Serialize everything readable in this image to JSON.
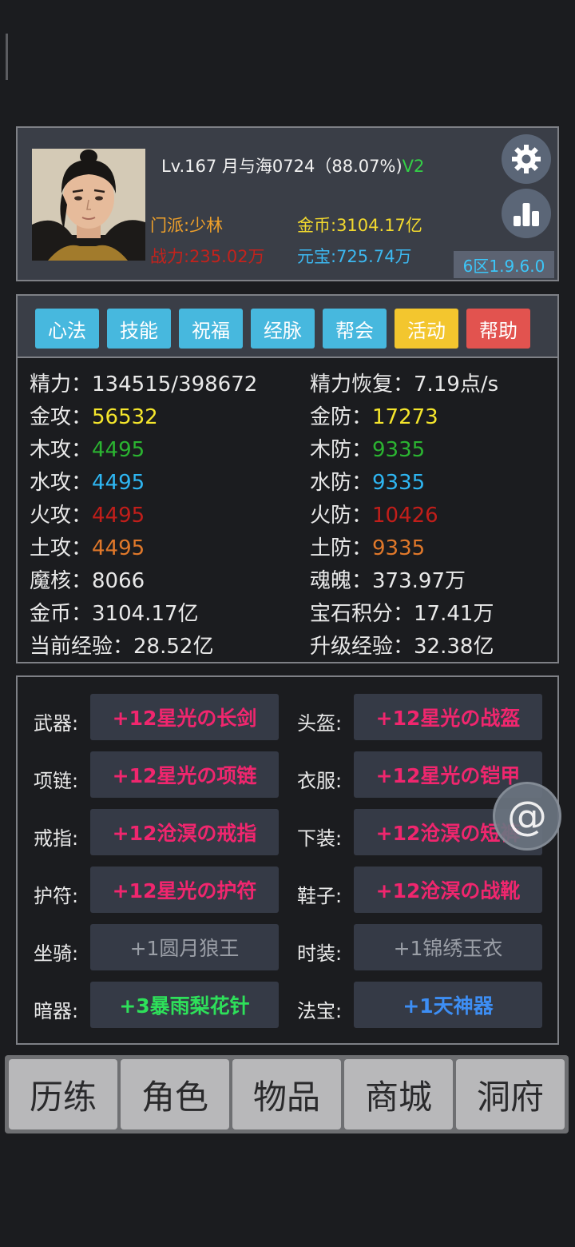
{
  "header": {
    "player_info": "Lv.167 月与海0724（88.07%)",
    "vip": "V2",
    "sect": "门派:少林",
    "power": "战力:235.02万",
    "gold": "金币:3104.17亿",
    "yuanbao": "元宝:725.74万",
    "server": "6区1.9.6.0",
    "icons": {
      "settings": "gear-icon",
      "stats": "bar-chart-icon"
    }
  },
  "tabs": [
    {
      "label": "心法",
      "color": "#47b8de"
    },
    {
      "label": "技能",
      "color": "#47b8de"
    },
    {
      "label": "祝福",
      "color": "#47b8de"
    },
    {
      "label": "经脉",
      "color": "#47b8de"
    },
    {
      "label": "帮会",
      "color": "#47b8de"
    },
    {
      "label": "活动",
      "color": "#f3c62e"
    },
    {
      "label": "帮助",
      "color": "#e2534f"
    }
  ],
  "stats": {
    "energy_label": "精力：",
    "energy_value": "134515/398672",
    "regen_label": "精力恢复：",
    "regen_value": "7.19点/s",
    "metal_atk_label": "金攻：",
    "metal_atk": "56532",
    "metal_def_label": "金防：",
    "metal_def": "17273",
    "wood_atk_label": "木攻：",
    "wood_atk": "4495",
    "wood_def_label": "木防：",
    "wood_def": "9335",
    "water_atk_label": "水攻：",
    "water_atk": "4495",
    "water_def_label": "水防：",
    "water_def": "9335",
    "fire_atk_label": "火攻：",
    "fire_atk": "4495",
    "fire_def_label": "火防：",
    "fire_def": "10426",
    "earth_atk_label": "土攻：",
    "earth_atk": "4495",
    "earth_def_label": "土防：",
    "earth_def": "9335",
    "core_label": "魔核：",
    "core": "8066",
    "soul_label": "魂魄：",
    "soul": "373.97万",
    "gold_label": "金币：",
    "gold": "3104.17亿",
    "gem_label": "宝石积分：",
    "gem": "17.41万",
    "exp_label": "当前经验：",
    "exp": "28.52亿",
    "lvl_exp_label": "升级经验：",
    "lvl_exp": "32.38亿"
  },
  "equipment": {
    "weapon_label": "武器:",
    "weapon": "+12星光の长剑",
    "helmet_label": "头盔:",
    "helmet": "+12星光の战盔",
    "necklace_label": "项链:",
    "necklace": "+12星光の项链",
    "armor_label": "衣服:",
    "armor": "+12星光の铠甲",
    "ring_label": "戒指:",
    "ring": "+12沧溟の戒指",
    "pants_label": "下装:",
    "pants": "+12沧溟の短裤",
    "amulet_label": "护符:",
    "amulet": "+12星光の护符",
    "boots_label": "鞋子:",
    "boots": "+12沧溟の战靴",
    "mount_label": "坐骑:",
    "mount": "+1圆月狼王",
    "fashion_label": "时装:",
    "fashion": "+1锦绣玉衣",
    "hidden_label": "暗器:",
    "hidden": "+3暴雨梨花针",
    "treasure_label": "法宝:",
    "treasure": "+1天神器"
  },
  "colors": {
    "metal": "#f5e62c",
    "wood": "#2bb431",
    "water": "#2eb6f2",
    "fire": "#c11e1a",
    "earth": "#e0782a",
    "pink": "#f0266e"
  },
  "float_button": "@",
  "nav": [
    "历练",
    "角色",
    "物品",
    "商城",
    "洞府"
  ]
}
